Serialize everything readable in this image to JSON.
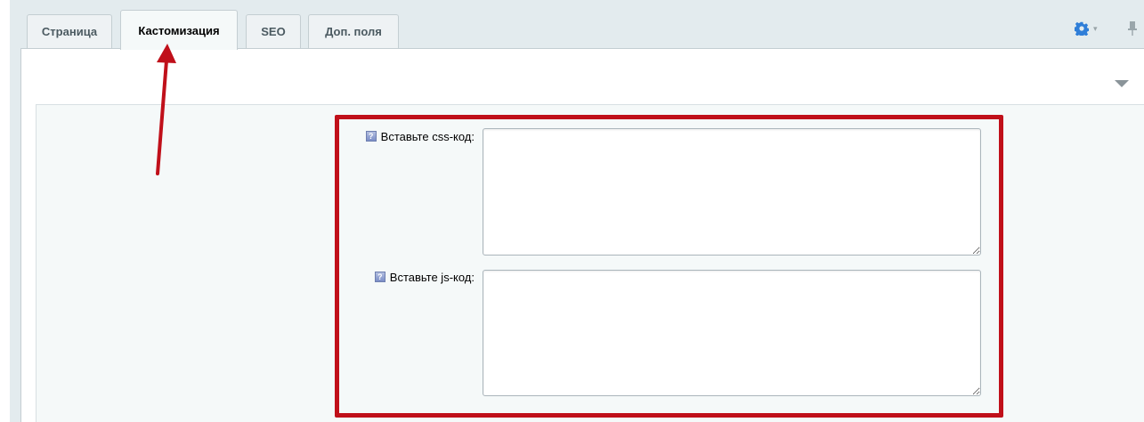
{
  "tabs": [
    {
      "label": "Страница",
      "active": false
    },
    {
      "label": "Кастомизация",
      "active": true
    },
    {
      "label": "SEO",
      "active": false
    },
    {
      "label": "Доп. поля",
      "active": false
    }
  ],
  "toolbar": {
    "settings_icon": "gear-icon",
    "pin_icon": "pin-icon"
  },
  "panel": {
    "collapse_icon": "triangle-down-icon"
  },
  "fields": {
    "css": {
      "label": "Вставьте css-код:",
      "value": ""
    },
    "js": {
      "label": "Вставьте js-код:",
      "value": ""
    }
  },
  "colors": {
    "annotation": "#c0101a",
    "accent": "#2f7ed8"
  }
}
